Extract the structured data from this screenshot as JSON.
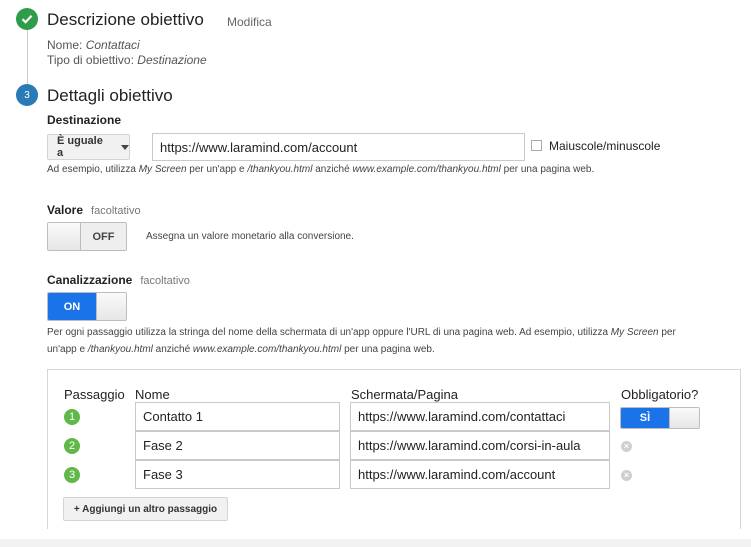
{
  "section1": {
    "title": "Descrizione obiettivo",
    "edit_label": "Modifica",
    "name_label": "Nome:",
    "name_value": "Contattaci",
    "type_label": "Tipo di obiettivo:",
    "type_value": "Destinazione"
  },
  "section2": {
    "step_number": "3",
    "title": "Dettagli obiettivo"
  },
  "destination": {
    "label": "Destinazione",
    "match_type": "È uguale a",
    "url_value": "https://www.laramind.com/account",
    "case_label": "Maiuscole/minuscole",
    "hint": {
      "p1": "Ad esempio, utilizza",
      "p2": "My Screen",
      "p3": "per un'app e",
      "p4": "/thankyou.html",
      "p5": "anziché",
      "p6": "www.example.com/thankyou.html",
      "p7": "per una pagina web."
    }
  },
  "value": {
    "label": "Valore",
    "optional": "facoltativo",
    "toggle_state": "OFF",
    "description": "Assegna un valore monetario alla conversione."
  },
  "funnel": {
    "label": "Canalizzazione",
    "optional": "facoltativo",
    "toggle_state": "ON",
    "hint": {
      "p1": "Per ogni passaggio utilizza la stringa del nome della schermata di un'app oppure l'URL di una pagina web. Ad esempio, utilizza",
      "p2": "My Screen",
      "p3": "per un'app e",
      "p4": "/thankyou.html",
      "p5": "anziché",
      "p6": "www.example.com/thankyou.html",
      "p7": "per una pagina web."
    },
    "headers": {
      "step": "Passaggio",
      "name": "Nome",
      "page": "Schermata/Pagina",
      "required": "Obbligatorio?"
    },
    "steps": [
      {
        "num": "1",
        "name": "Contatto 1",
        "page": "https://www.laramind.com/contattaci"
      },
      {
        "num": "2",
        "name": "Fase 2",
        "page": "https://www.laramind.com/corsi-in-aula"
      },
      {
        "num": "3",
        "name": "Fase 3",
        "page": "https://www.laramind.com/account"
      }
    ],
    "required_toggle": "SÌ",
    "add_step_label": "+ Aggiungi un altro passaggio"
  },
  "colors": {
    "success_green": "#2e9c4a",
    "step_blue": "#2a7ab8",
    "toggle_blue": "#1a73e8",
    "funnel_green": "#5fb847"
  }
}
